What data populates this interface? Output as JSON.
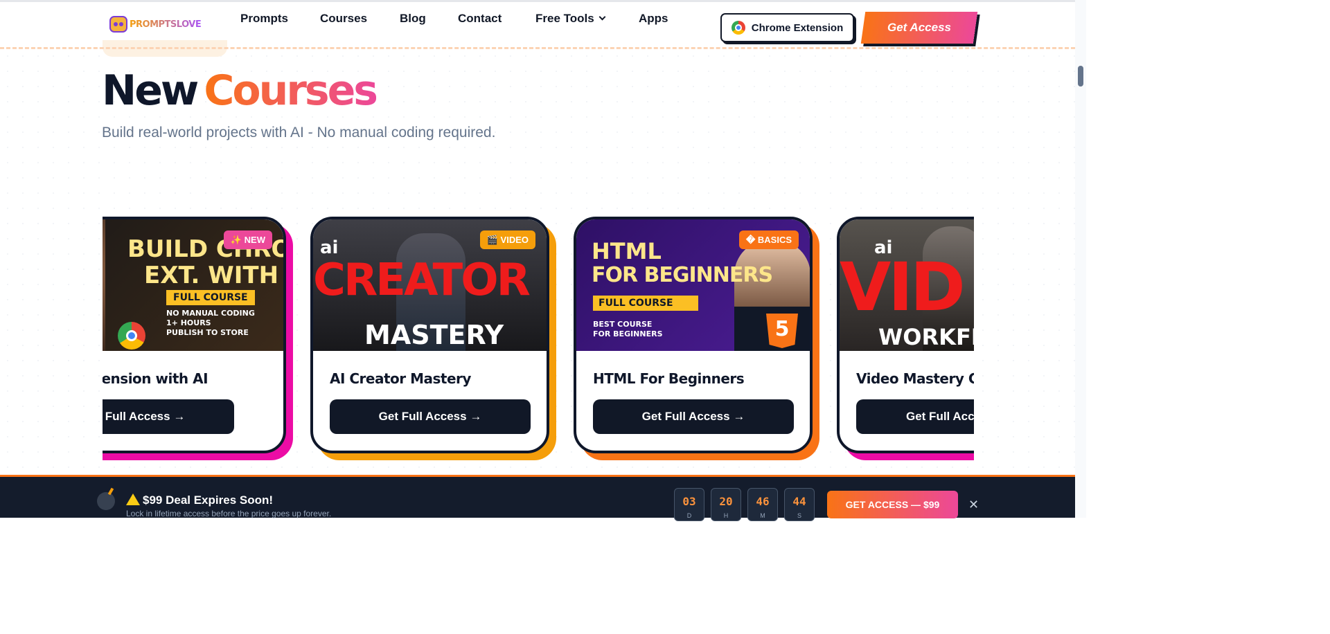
{
  "brand": {
    "logo_text": "PROMPTSLOVE",
    "accent_start": "#f97316",
    "accent_end": "#ec4899",
    "dark": "#0f172a"
  },
  "nav": {
    "items": [
      "Prompts",
      "Courses",
      "Blog",
      "Contact",
      "Free Tools",
      "Apps"
    ],
    "chrome_extension_label": "Chrome Extension",
    "get_access_label": "Get Access"
  },
  "hero": {
    "title_part1": "New",
    "title_part2": "Courses",
    "subtitle": "Build real-world projects with AI - No manual coding required."
  },
  "courses": [
    {
      "title": "me Extension with AI",
      "button": "Get Full Access →",
      "badge": "✨ NEW",
      "badge_color": "#ec4899",
      "shadow_color": "#ec0ca5",
      "thumb_lines": [
        "BUILD CHROME",
        "EXT. WITH AI",
        "FULL COURSE",
        "NO MANUAL CODING",
        "1+ HOURS",
        "PUBLISH TO STORE"
      ]
    },
    {
      "title": "AI Creator Mastery",
      "button": "Get Full Access →",
      "badge": "🎬 VIDEO",
      "badge_color": "#f59e0b",
      "shadow_color": "#f59e0b",
      "thumb_lines": [
        "ai",
        "CREATOR",
        "MASTERY"
      ]
    },
    {
      "title": "HTML For Beginners",
      "button": "Get Full Access →",
      "badge": "� BASICS",
      "badge_color": "#f97316",
      "shadow_color": "#f97316",
      "thumb_lines": [
        "HTML",
        "FOR BEGINNERS",
        "FULL COURSE",
        "BEST COURSE",
        "FOR BEGINNERS",
        "5"
      ]
    },
    {
      "title": "Video Mastery C",
      "button": "Get Full Acc",
      "badge": "",
      "badge_color": "#ec4899",
      "shadow_color": "#ec0ca5",
      "thumb_lines": [
        "ai",
        "VID",
        "WORKFL"
      ]
    }
  ],
  "deal": {
    "title": "$99 Deal Expires Soon!",
    "subtitle": "Lock in lifetime access before the price goes up forever.",
    "timer": [
      {
        "value": "03",
        "unit": "D"
      },
      {
        "value": "20",
        "unit": "H"
      },
      {
        "value": "46",
        "unit": "M"
      },
      {
        "value": "44",
        "unit": "S"
      }
    ],
    "button": "GET ACCESS — $99",
    "close": "✕"
  }
}
